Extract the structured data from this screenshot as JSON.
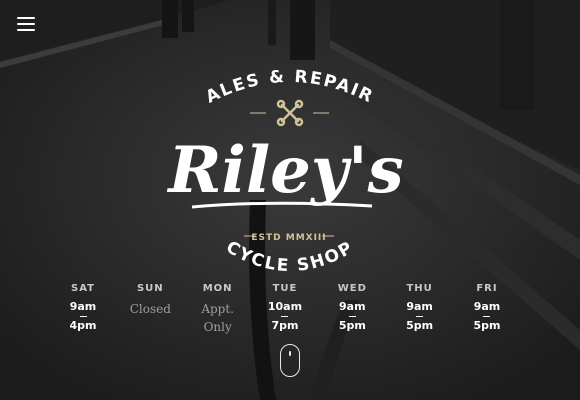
{
  "nav": {
    "menu_icon": "hamburger-menu-icon"
  },
  "logo": {
    "tagline": "SALES & REPAIRS",
    "name": "Riley's",
    "established": "ESTD MMXIII",
    "subtitle": "CYCLE SHOP",
    "emblem_icon": "crossed-wrenches-icon"
  },
  "hours": [
    {
      "day": "SAT",
      "open": "9am",
      "close": "4pm"
    },
    {
      "day": "SUN",
      "closed": "Closed"
    },
    {
      "day": "MON",
      "note1": "Appt.",
      "note2": "Only"
    },
    {
      "day": "TUE",
      "open": "10am",
      "close": "7pm"
    },
    {
      "day": "WED",
      "open": "9am",
      "close": "5pm"
    },
    {
      "day": "THU",
      "open": "9am",
      "close": "5pm"
    },
    {
      "day": "FRI",
      "open": "9am",
      "close": "5pm"
    }
  ],
  "scroll_indicator": {
    "icon": "mouse-scroll-icon"
  },
  "colors": {
    "accent": "#cfc39a",
    "text": "#ffffff",
    "muted": "#9e9e9e",
    "background": "#262626"
  }
}
